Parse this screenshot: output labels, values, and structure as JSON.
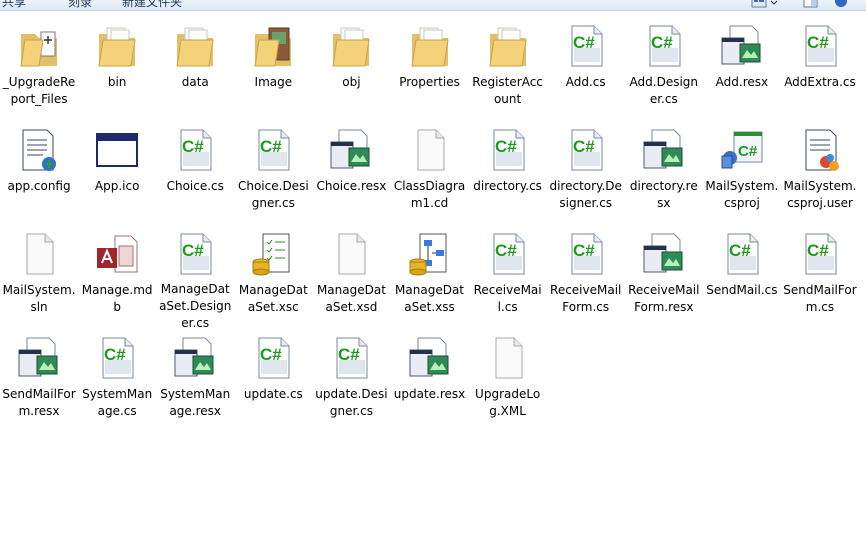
{
  "toolbar": {
    "share": "共享",
    "burn": "刻录",
    "new_folder": "新建文件夹"
  },
  "files": [
    {
      "name": "_UpgradeReport_Files",
      "icon": "folder-file-icon"
    },
    {
      "name": "bin",
      "icon": "folder-icon"
    },
    {
      "name": "data",
      "icon": "folder-icon"
    },
    {
      "name": "Image",
      "icon": "folder-image-icon"
    },
    {
      "name": "obj",
      "icon": "folder-icon"
    },
    {
      "name": "Properties",
      "icon": "folder-icon"
    },
    {
      "name": "RegisterAccount",
      "icon": "folder-icon"
    },
    {
      "name": "Add.cs",
      "icon": "csharp-file-icon"
    },
    {
      "name": "Add.Designer.cs",
      "icon": "csharp-file-icon"
    },
    {
      "name": "Add.resx",
      "icon": "resx-file-icon"
    },
    {
      "name": "AddExtra.cs",
      "icon": "csharp-file-icon"
    },
    {
      "name": "app.config",
      "icon": "config-file-icon"
    },
    {
      "name": "App.ico",
      "icon": "window-icon"
    },
    {
      "name": "Choice.cs",
      "icon": "csharp-file-icon"
    },
    {
      "name": "Choice.Designer.cs",
      "icon": "csharp-file-icon"
    },
    {
      "name": "Choice.resx",
      "icon": "resx-file-icon"
    },
    {
      "name": "ClassDiagram1.cd",
      "icon": "blank-file-icon"
    },
    {
      "name": "directory.cs",
      "icon": "csharp-file-icon"
    },
    {
      "name": "directory.Designer.cs",
      "icon": "csharp-file-icon"
    },
    {
      "name": "directory.resx",
      "icon": "resx-file-icon"
    },
    {
      "name": "MailSystem.csproj",
      "icon": "csproj-file-icon"
    },
    {
      "name": "MailSystem.csproj.user",
      "icon": "csproj-user-file-icon"
    },
    {
      "name": "MailSystem.sln",
      "icon": "blank-file-icon"
    },
    {
      "name": "Manage.mdb",
      "icon": "access-db-icon"
    },
    {
      "name": "ManageDataSet.Designer.cs",
      "icon": "csharp-file-icon"
    },
    {
      "name": "ManageDataSet.xsc",
      "icon": "dataset-checklist-icon"
    },
    {
      "name": "ManageDataSet.xsd",
      "icon": "blank-file-icon"
    },
    {
      "name": "ManageDataSet.xss",
      "icon": "dataset-diagram-icon"
    },
    {
      "name": "ReceiveMail.cs",
      "icon": "csharp-file-icon"
    },
    {
      "name": "ReceiveMailForm.cs",
      "icon": "csharp-file-icon"
    },
    {
      "name": "ReceiveMailForm.resx",
      "icon": "resx-file-icon"
    },
    {
      "name": "SendMail.cs",
      "icon": "csharp-file-icon"
    },
    {
      "name": "SendMailForm.cs",
      "icon": "csharp-file-icon"
    },
    {
      "name": "SendMailForm.resx",
      "icon": "resx-file-icon"
    },
    {
      "name": "SystemManage.cs",
      "icon": "csharp-file-icon"
    },
    {
      "name": "SystemManage.resx",
      "icon": "resx-file-icon"
    },
    {
      "name": "update.cs",
      "icon": "csharp-file-icon"
    },
    {
      "name": "update.Designer.cs",
      "icon": "csharp-file-icon"
    },
    {
      "name": "update.resx",
      "icon": "resx-file-icon"
    },
    {
      "name": "UpgradeLog.XML",
      "icon": "blank-file-icon"
    }
  ]
}
